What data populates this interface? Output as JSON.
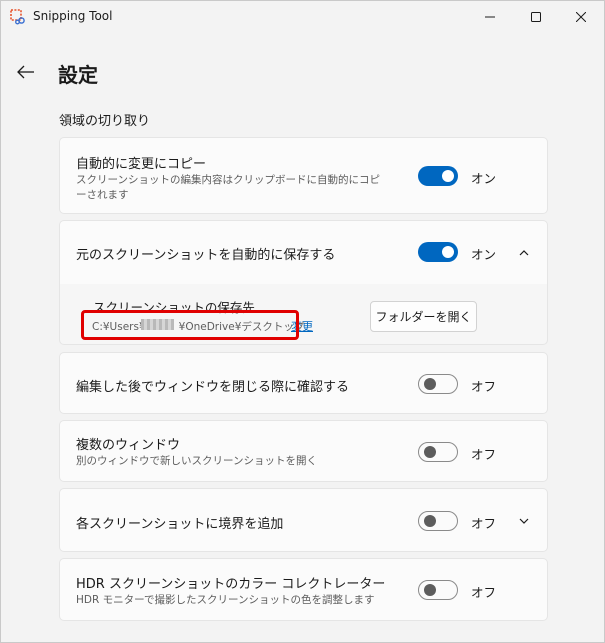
{
  "window": {
    "title": "Snipping Tool",
    "minimize": "—",
    "maximize": "☐",
    "close": "✕"
  },
  "header": {
    "title": "設定",
    "section": "領域の切り取り"
  },
  "settings": {
    "auto_copy": {
      "title": "自動的に変更にコピー",
      "desc": "スクリーンショットの編集内容はクリップボードに自動的にコピーされます",
      "state": "オン"
    },
    "auto_save": {
      "title": "元のスクリーンショットを自動的に保存する",
      "state": "オン",
      "save_location_label": "スクリーンショットの保存先",
      "save_path_prefix": "C:¥Users¥",
      "save_path_suffix": "¥OneDrive¥デスクトップ",
      "change_link": "変更",
      "open_folder_button": "フォルダーを開く"
    },
    "confirm_close": {
      "title": "編集した後でウィンドウを閉じる際に確認する",
      "state": "オフ"
    },
    "multi_window": {
      "title": "複数のウィンドウ",
      "desc": "別のウィンドウで新しいスクリーンショットを開く",
      "state": "オフ"
    },
    "add_border": {
      "title": "各スクリーンショットに境界を追加",
      "state": "オフ"
    },
    "hdr": {
      "title": "HDR スクリーンショットのカラー コレクトレーター",
      "desc": "HDR モニターで撮影したスクリーンショットの色を調整します",
      "state": "オフ"
    }
  },
  "colors": {
    "accent": "#0067c0",
    "highlight": "#e00000"
  }
}
